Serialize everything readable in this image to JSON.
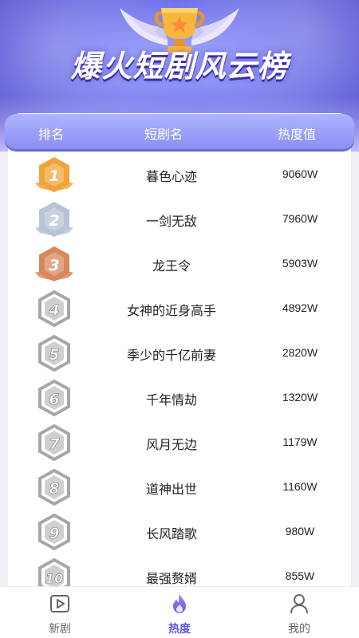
{
  "banner": {
    "title": "爆火短剧风云榜"
  },
  "columns": {
    "rank": "排名",
    "name": "短剧名",
    "heat": "热度值"
  },
  "list": [
    {
      "rank": "1",
      "title": "暮色心迹",
      "heat": "9060W",
      "tier": "gold"
    },
    {
      "rank": "2",
      "title": "一剑无敌",
      "heat": "7960W",
      "tier": "silver"
    },
    {
      "rank": "3",
      "title": "龙王令",
      "heat": "5903W",
      "tier": "bronze"
    },
    {
      "rank": "4",
      "title": "女神的近身高手",
      "heat": "4892W",
      "tier": "plain"
    },
    {
      "rank": "5",
      "title": "季少的千亿前妻",
      "heat": "2820W",
      "tier": "plain"
    },
    {
      "rank": "6",
      "title": "千年情劫",
      "heat": "1320W",
      "tier": "plain"
    },
    {
      "rank": "7",
      "title": "风月无边",
      "heat": "1179W",
      "tier": "plain"
    },
    {
      "rank": "8",
      "title": "道神出世",
      "heat": "1160W",
      "tier": "plain"
    },
    {
      "rank": "9",
      "title": "长风踏歌",
      "heat": "980W",
      "tier": "plain"
    },
    {
      "rank": "10",
      "title": "最强赘婿",
      "heat": "855W",
      "tier": "plain"
    }
  ],
  "tabs": [
    {
      "label": "新剧",
      "icon": "video-play-icon",
      "active": false
    },
    {
      "label": "热度",
      "icon": "flame-icon",
      "active": true
    },
    {
      "label": "我的",
      "icon": "user-icon",
      "active": false
    }
  ],
  "colors": {
    "accent": "#5a57e6",
    "gold": "#f0a43a",
    "silver": "#b9c3d6",
    "bronze": "#d9885c",
    "plain": "#a7a7a7"
  }
}
